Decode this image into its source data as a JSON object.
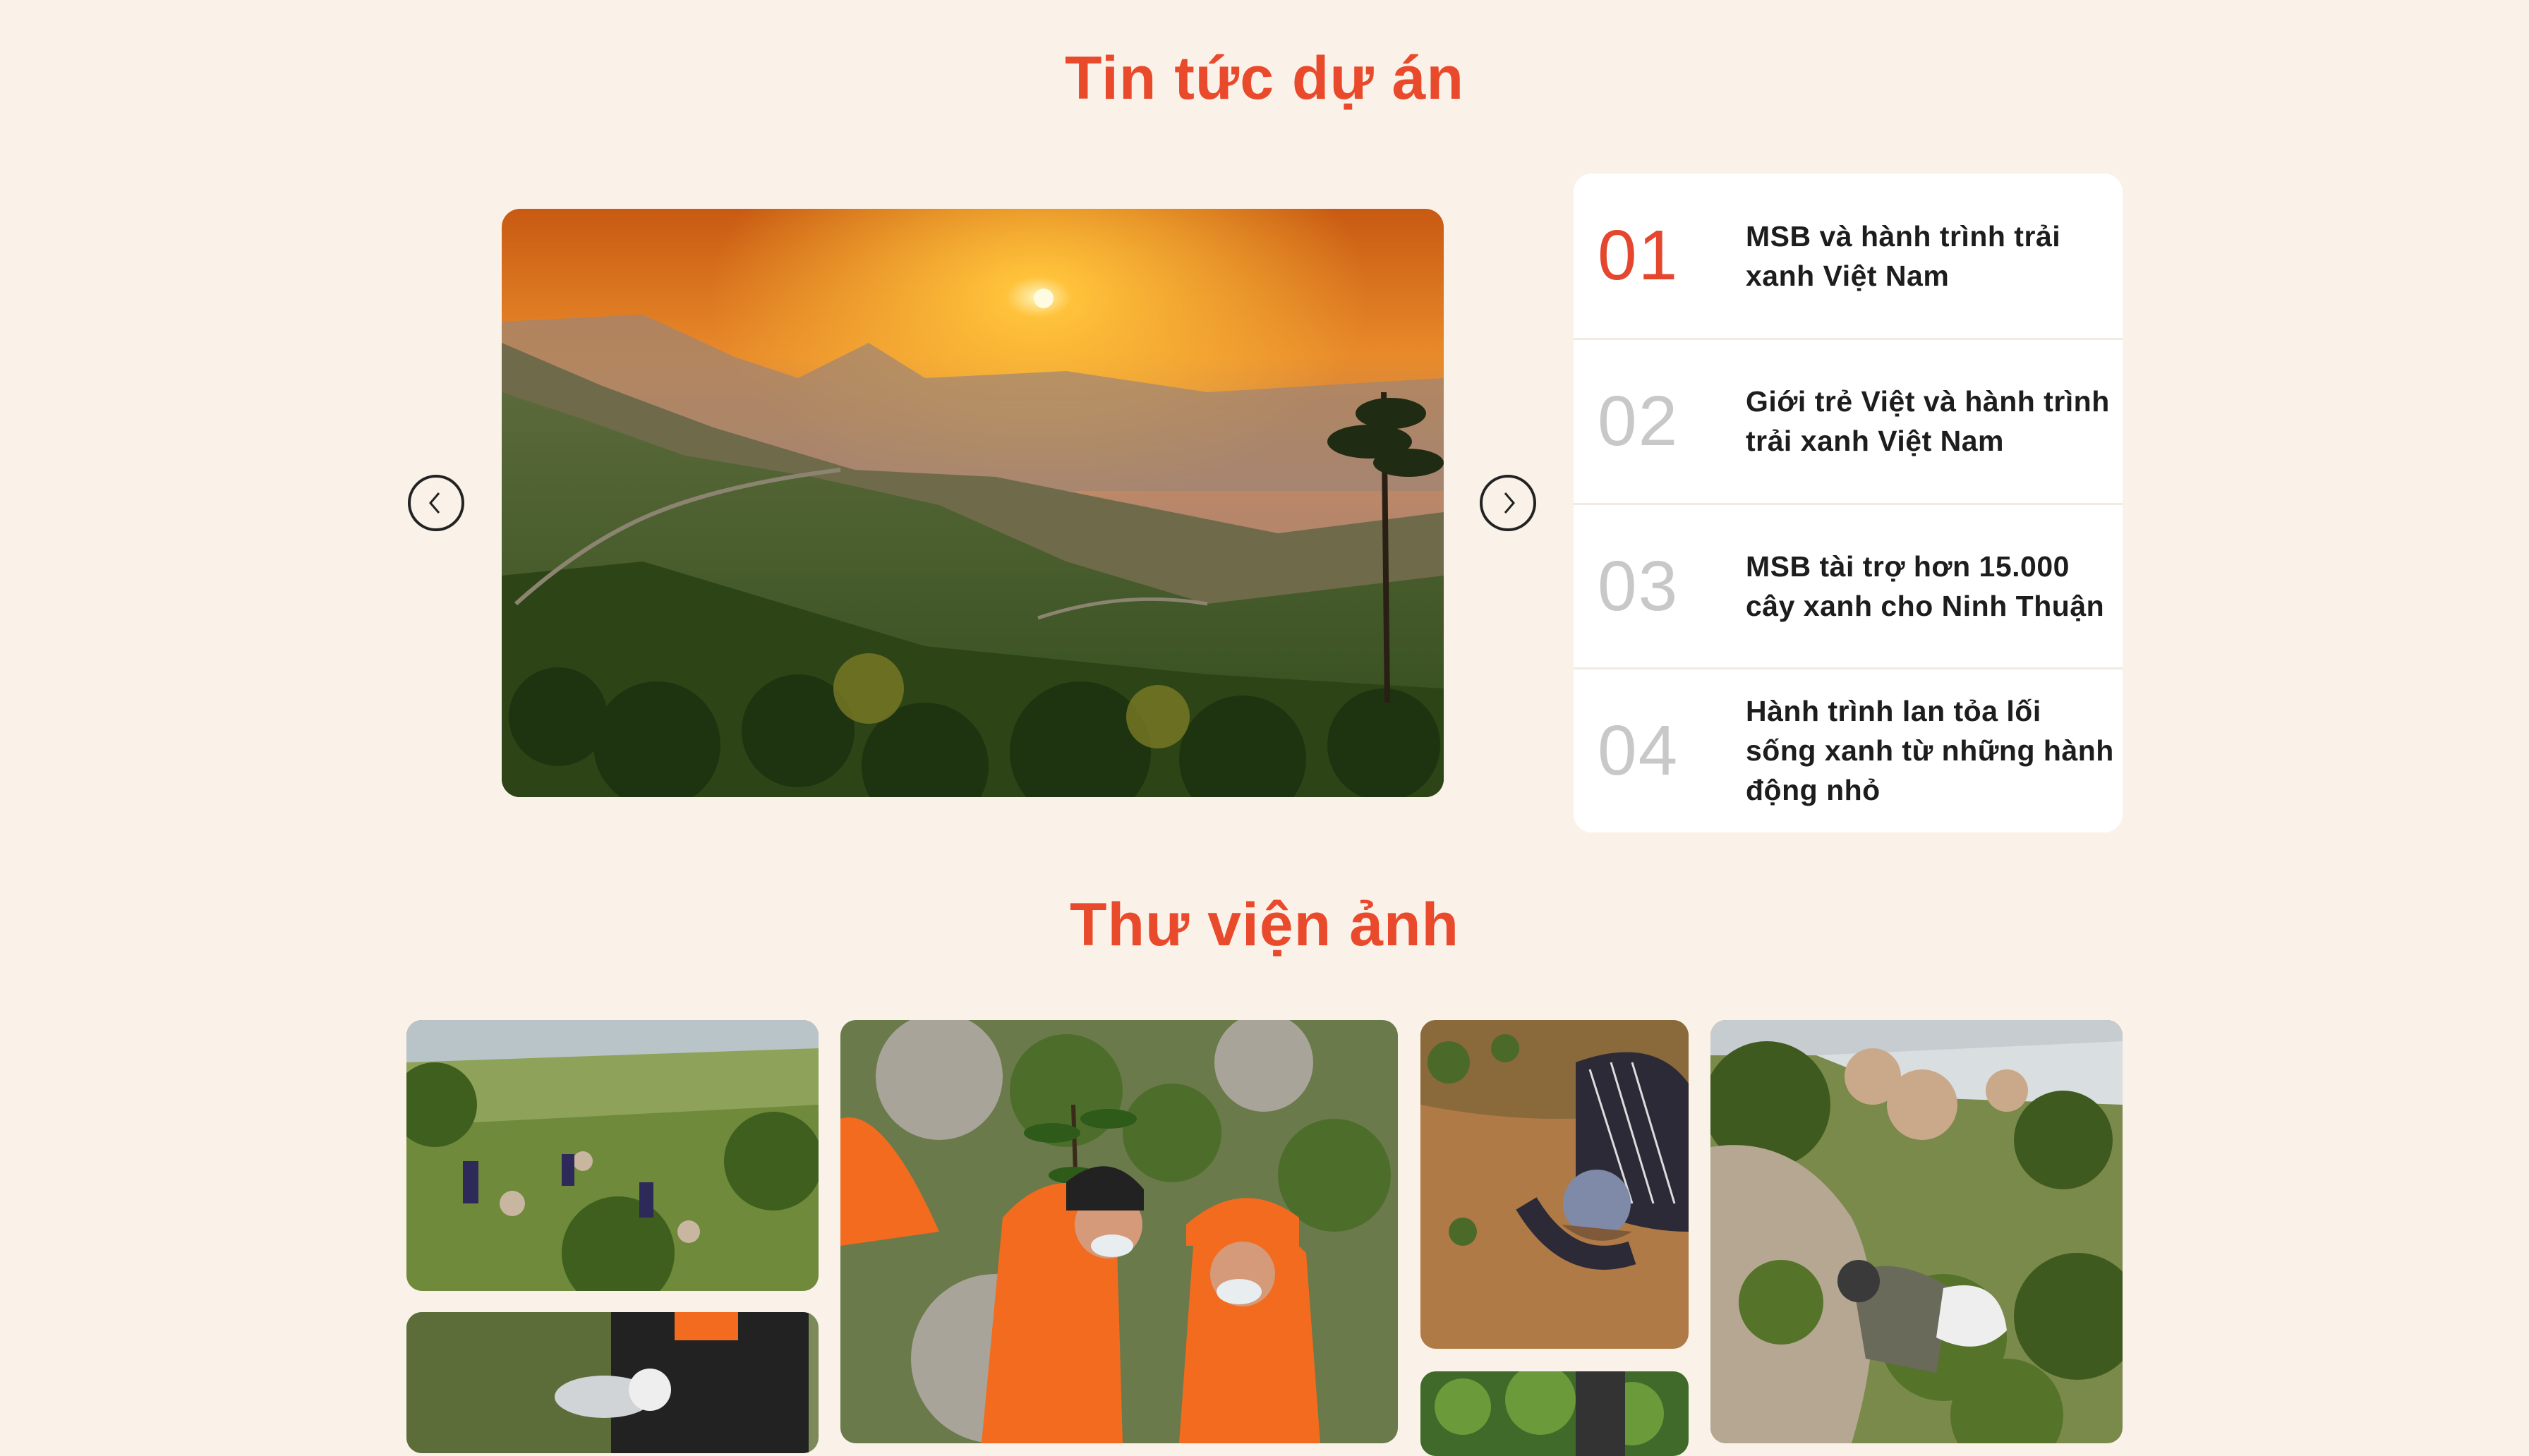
{
  "news": {
    "title": "Tin tức dự án",
    "items": [
      {
        "number": "01",
        "title": "MSB và hành trình trải xanh Việt Nam"
      },
      {
        "number": "02",
        "title": "Giới trẻ Việt và hành trình trải xanh Việt Nam"
      },
      {
        "number": "03",
        "title": "MSB tài trợ hơn 15.000 cây xanh cho Ninh Thuận"
      },
      {
        "number": "04",
        "title": "Hành trình lan tỏa lối sống xanh từ những hành động nhỏ"
      }
    ],
    "active_index": 0
  },
  "slider": {
    "prev_icon": "chevron-left-icon",
    "next_icon": "chevron-right-icon",
    "current_image": "sunset-mountain-landscape"
  },
  "gallery": {
    "title": "Thư viện ảnh",
    "photos": [
      "volunteers-planting-on-hillside",
      "volunteers-planting-sapling",
      "person-digging-soil",
      "volunteer-on-rocky-hill",
      "watering-bucket",
      "green-shrubs"
    ]
  },
  "colors": {
    "accent": "#ea4a2c",
    "background": "#faf2e9",
    "number_inactive": "#c8c8c8"
  }
}
